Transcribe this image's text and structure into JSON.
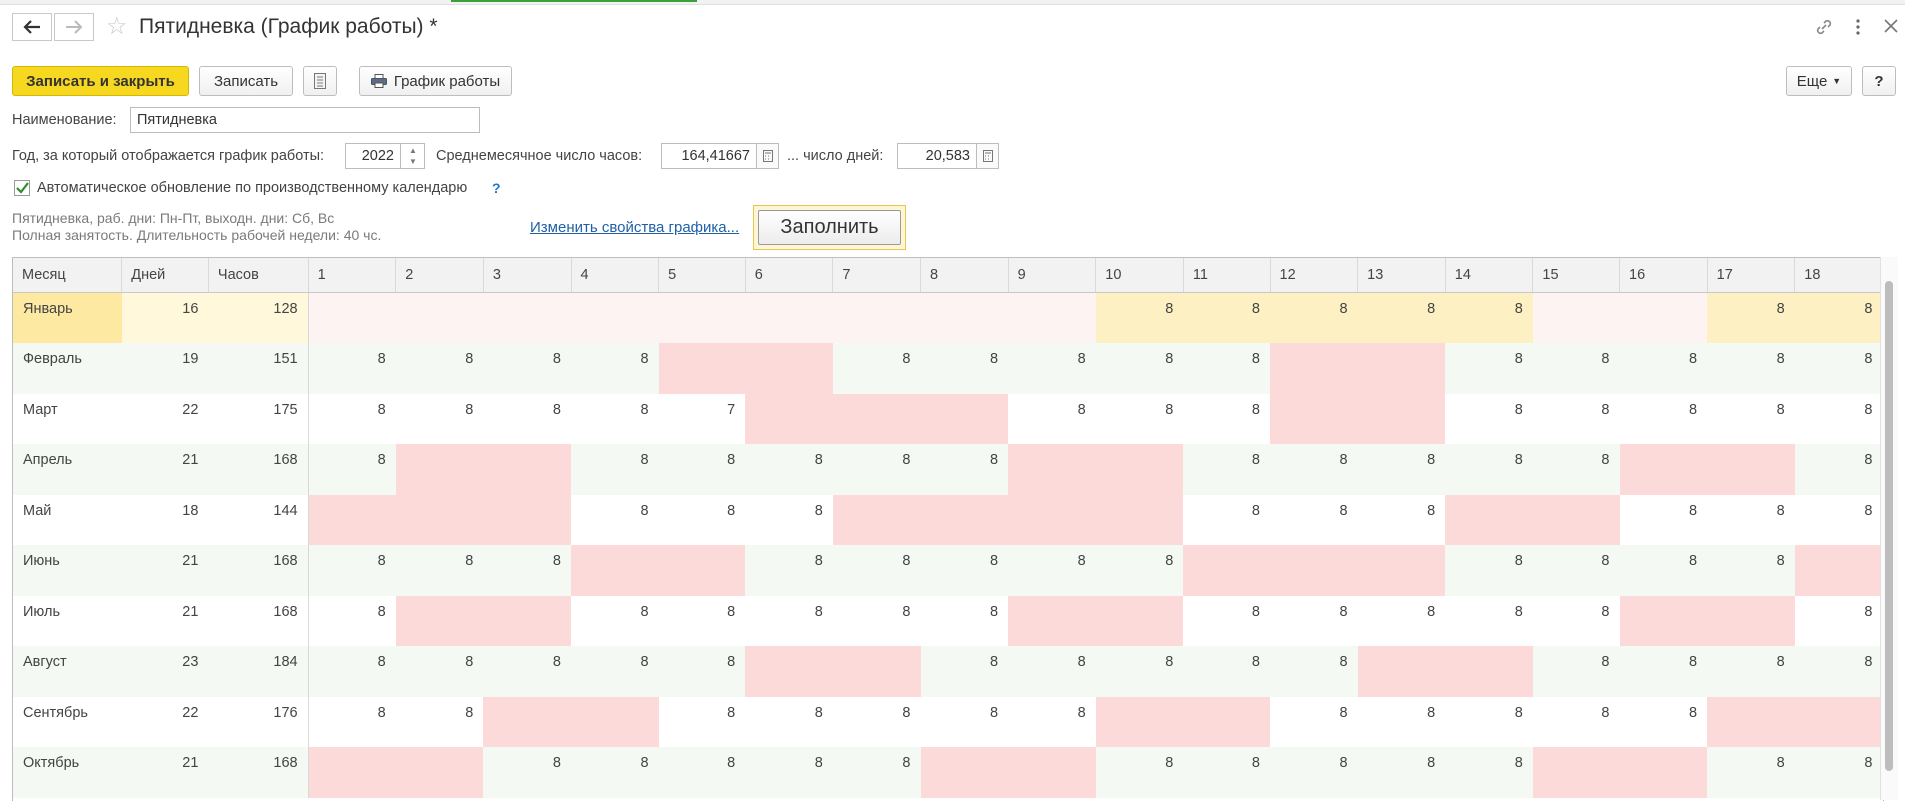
{
  "window": {
    "title": "Пятидневка (График работы) *"
  },
  "toolbar": {
    "save_close": "Записать и закрыть",
    "save": "Записать",
    "schedule": "График работы",
    "more": "Еще",
    "help": "?"
  },
  "form": {
    "name_label": "Наименование:",
    "name_value": "Пятидневка",
    "year_label": "Год, за который отображается график работы:",
    "year_value": "2022",
    "avg_hours_label": "Среднемесячное число часов:",
    "avg_hours_value": "164,41667",
    "avg_days_label": "... число дней:",
    "avg_days_value": "20,583",
    "auto_update_label": "Автоматическое обновление по производственному календарю",
    "auto_update_hint": "?",
    "info_line1": "Пятидневка, раб. дни: Пн-Пт, выходн. дни: Сб, Вс",
    "info_line2": "Полная занятость. Длительность рабочей недели: 40 чс.",
    "change_link": "Изменить свойства графика...",
    "fill_button": "Заполнить"
  },
  "grid": {
    "headers": [
      "Месяц",
      "Дней",
      "Часов",
      "1",
      "2",
      "3",
      "4",
      "5",
      "6",
      "7",
      "8",
      "9",
      "10",
      "11",
      "12",
      "13",
      "14",
      "15",
      "16",
      "17",
      "18"
    ],
    "rows": [
      {
        "month": "Январь",
        "days": "16",
        "hours": "128",
        "cells": [
          "",
          "",
          "",
          "",
          "",
          "",
          "",
          "",
          "",
          "8",
          "8",
          "8",
          "8",
          "8",
          "",
          "",
          "8",
          "8"
        ]
      },
      {
        "month": "Февраль",
        "days": "19",
        "hours": "151",
        "cells": [
          "8",
          "8",
          "8",
          "8",
          "",
          "",
          "8",
          "8",
          "8",
          "8",
          "8",
          "",
          "",
          "8",
          "8",
          "8",
          "8",
          "8"
        ]
      },
      {
        "month": "Март",
        "days": "22",
        "hours": "175",
        "cells": [
          "8",
          "8",
          "8",
          "8",
          "7",
          "",
          "",
          "",
          "8",
          "8",
          "8",
          "",
          "",
          "8",
          "8",
          "8",
          "8",
          "8"
        ]
      },
      {
        "month": "Апрель",
        "days": "21",
        "hours": "168",
        "cells": [
          "8",
          "",
          "",
          "8",
          "8",
          "8",
          "8",
          "8",
          "",
          "",
          "8",
          "8",
          "8",
          "8",
          "8",
          "",
          "",
          "8"
        ]
      },
      {
        "month": "Май",
        "days": "18",
        "hours": "144",
        "cells": [
          "",
          "",
          "",
          "8",
          "8",
          "8",
          "",
          "",
          "",
          "",
          "8",
          "8",
          "8",
          "",
          "",
          "8",
          "8",
          "8"
        ]
      },
      {
        "month": "Июнь",
        "days": "21",
        "hours": "168",
        "cells": [
          "8",
          "8",
          "8",
          "",
          "",
          "8",
          "8",
          "8",
          "8",
          "8",
          "",
          "",
          "",
          "8",
          "8",
          "8",
          "8",
          ""
        ]
      },
      {
        "month": "Июль",
        "days": "21",
        "hours": "168",
        "cells": [
          "8",
          "",
          "",
          "8",
          "8",
          "8",
          "8",
          "8",
          "",
          "",
          "8",
          "8",
          "8",
          "8",
          "8",
          "",
          "",
          "8"
        ]
      },
      {
        "month": "Август",
        "days": "23",
        "hours": "184",
        "cells": [
          "8",
          "8",
          "8",
          "8",
          "8",
          "",
          "",
          "8",
          "8",
          "8",
          "8",
          "8",
          "",
          "",
          "8",
          "8",
          "8",
          "8"
        ]
      },
      {
        "month": "Сентябрь",
        "days": "22",
        "hours": "176",
        "cells": [
          "8",
          "8",
          "",
          "",
          "8",
          "8",
          "8",
          "8",
          "8",
          "",
          "",
          "8",
          "8",
          "8",
          "8",
          "8",
          "",
          ""
        ]
      },
      {
        "month": "Октябрь",
        "days": "21",
        "hours": "168",
        "cells": [
          "",
          "",
          "8",
          "8",
          "8",
          "8",
          "8",
          "",
          "",
          "8",
          "8",
          "8",
          "8",
          "8",
          "",
          "",
          "8",
          "8"
        ]
      }
    ]
  },
  "colors": {
    "weekend": "#fddada",
    "selected_row": "#fff8db",
    "accent": "#f7d820"
  }
}
